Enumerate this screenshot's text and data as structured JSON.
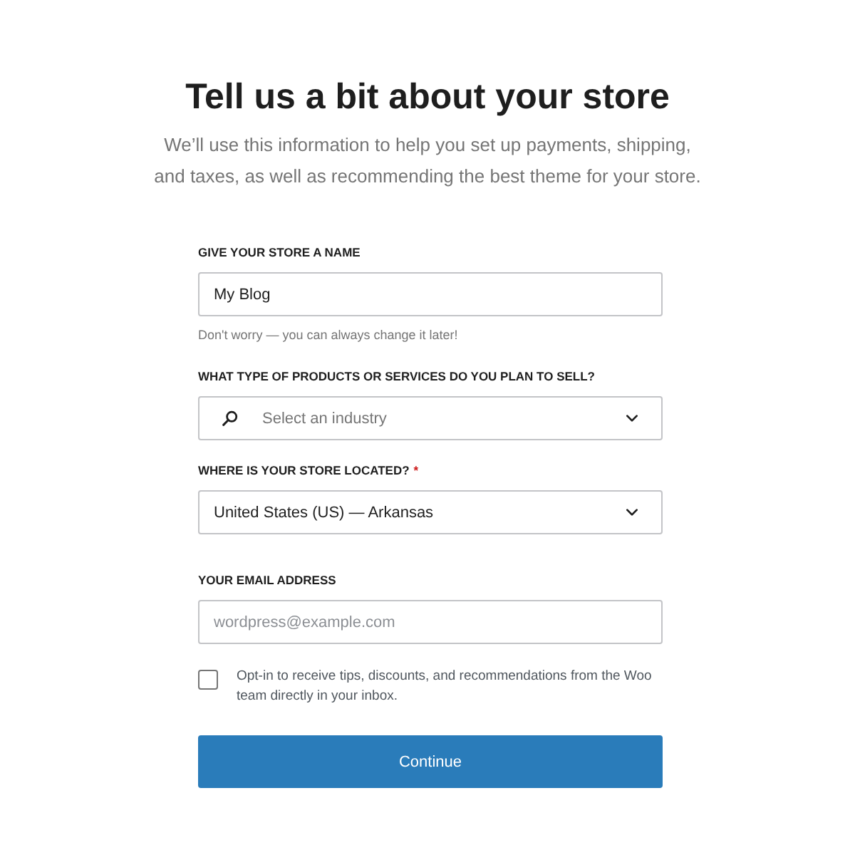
{
  "title": "Tell us a bit about your store",
  "subtitle": "We’ll use this information to help you set up payments, shipping, and taxes, as well as recommending the best theme for your store.",
  "fields": [
    {
      "kind": "text",
      "label": "GIVE YOUR STORE A NAME",
      "value": "My Blog",
      "help": "Don't worry — you can always change it later!"
    },
    {
      "kind": "search-select",
      "label": "WHAT TYPE OF PRODUCTS OR SERVICES DO YOU PLAN TO SELL?",
      "placeholder": "Select an industry"
    },
    {
      "kind": "select",
      "label": "WHERE IS YOUR STORE LOCATED?",
      "required_mark": "*",
      "value": "United States (US) — Arkansas"
    },
    {
      "kind": "text",
      "label": "YOUR EMAIL ADDRESS",
      "placeholder": "wordpress@example.com"
    }
  ],
  "opt_in": {
    "label": "Opt-in to receive tips, discounts, and recommendations from the Woo team directly in your inbox.",
    "checked": false
  },
  "continue_button": "Continue"
}
